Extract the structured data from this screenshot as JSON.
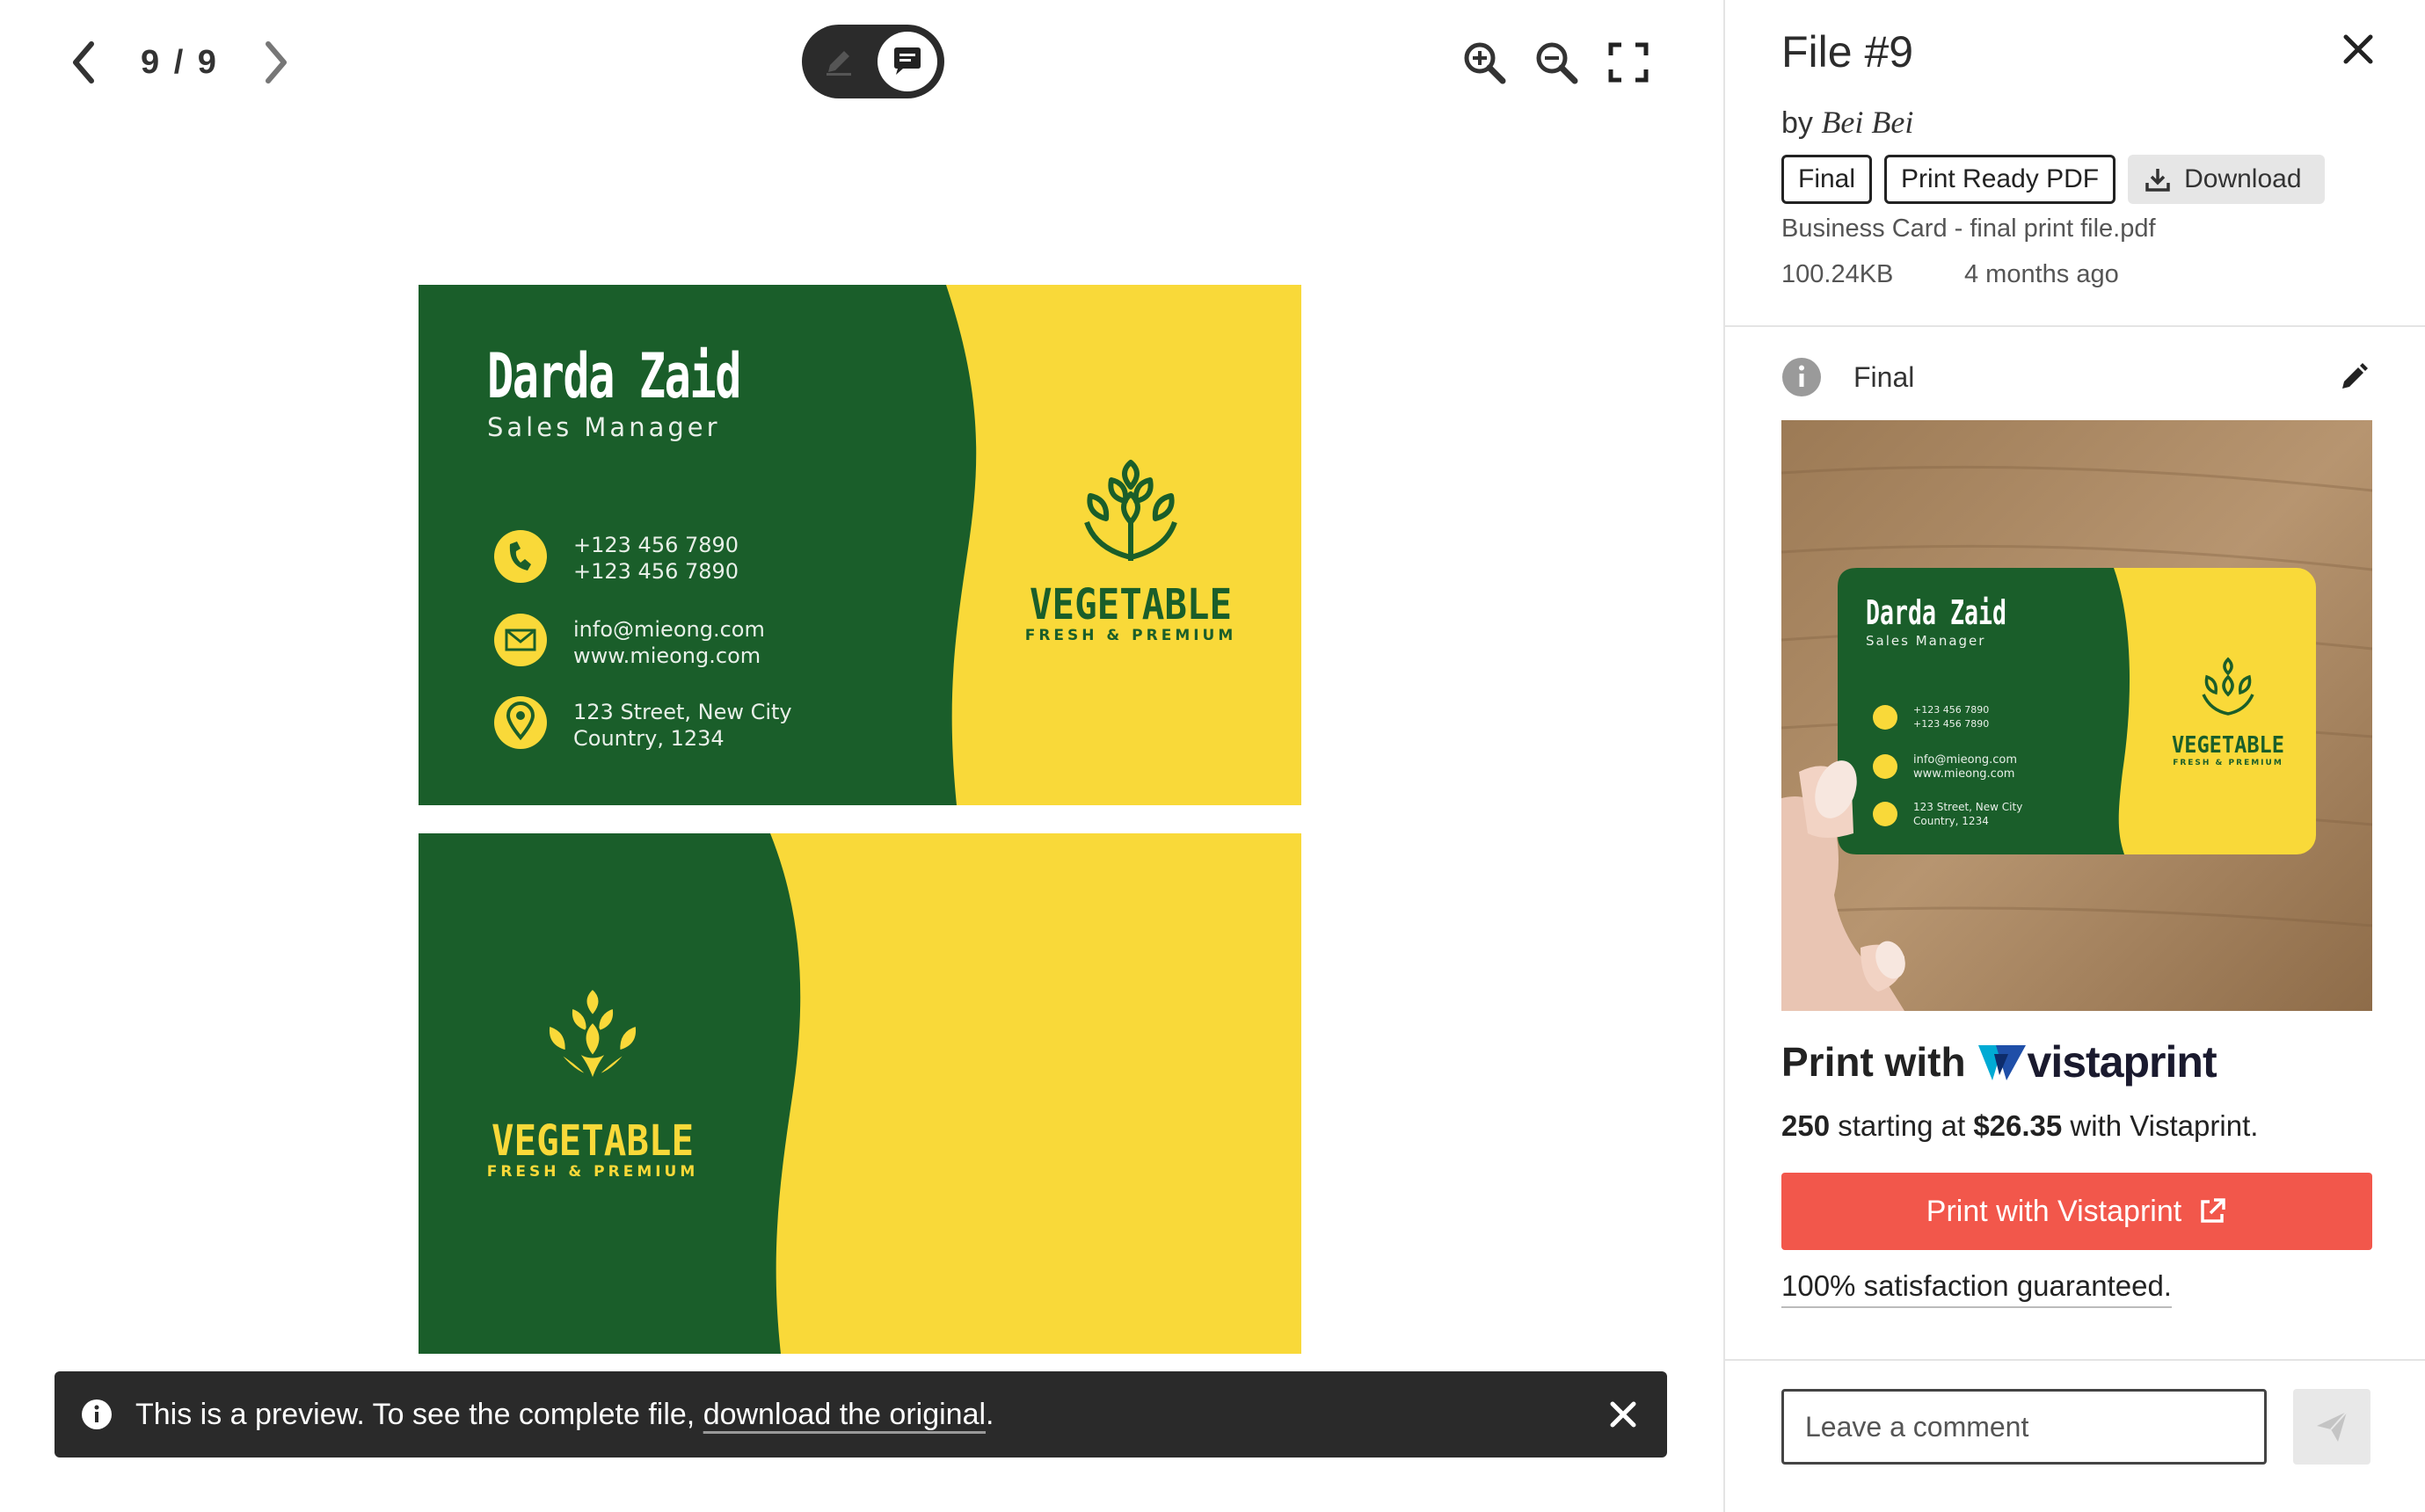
{
  "viewer": {
    "pager": {
      "current": "9",
      "separator": "/",
      "total": "9",
      "count_text": "9 / 9"
    },
    "preview_notice": {
      "text_before": "This is a preview. To see the complete file, ",
      "link": "download the original",
      "text_after": "."
    }
  },
  "card": {
    "name": "Darda Zaid",
    "role": "Sales Manager",
    "phone1": "+123 456 7890",
    "phone2": "+123 456 7890",
    "email": "info@mieong.com",
    "website": "www.mieong.com",
    "address1": "123 Street, New City",
    "address2": "Country, 1234",
    "brand": "VEGETABLE",
    "tagline": "FRESH & PREMIUM",
    "colors": {
      "green": "#1a5e2a",
      "yellow": "#f9d939"
    }
  },
  "panel": {
    "title": "File #9",
    "by": "by",
    "author": "Bei Bei",
    "tags": [
      "Final",
      "Print Ready PDF"
    ],
    "download_label": "Download",
    "filename": "Business Card - final print file.pdf",
    "filesize": "100.24KB",
    "age": "4 months ago",
    "version_label": "Final",
    "print_with": "Print with",
    "vistaprint_word": "vistaprint",
    "price_qty": "250",
    "price_mid": " starting at ",
    "price_amount": "$26.35",
    "price_end": " with Vistaprint.",
    "cta": "Print with Vistaprint",
    "guarantee": "100% satisfaction guaranteed.",
    "comment_placeholder": "Leave a comment",
    "accent": "#f2574b"
  },
  "icons": [
    "chevron-left-icon",
    "chevron-right-icon",
    "pencil-icon",
    "comment-icon",
    "zoom-in-icon",
    "zoom-out-icon",
    "fullscreen-icon",
    "info-icon",
    "close-icon",
    "download-icon",
    "edit-icon",
    "external-link-icon",
    "send-icon"
  ]
}
